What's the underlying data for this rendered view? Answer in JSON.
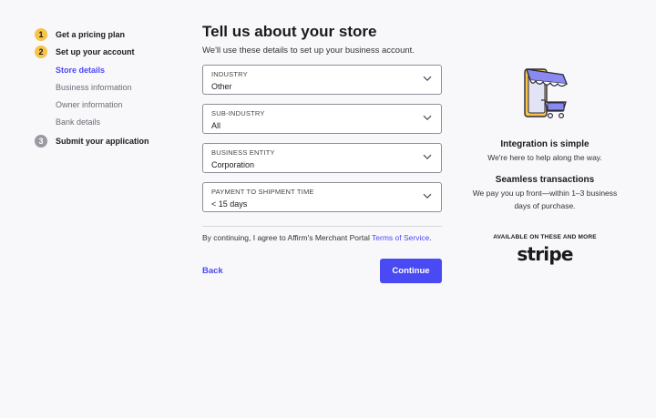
{
  "stepper": {
    "steps": [
      {
        "number": "1",
        "label": "Get a pricing plan"
      },
      {
        "number": "2",
        "label": "Set up your account"
      },
      {
        "number": "3",
        "label": "Submit your application"
      }
    ],
    "substeps": [
      {
        "label": "Store details"
      },
      {
        "label": "Business information"
      },
      {
        "label": "Owner information"
      },
      {
        "label": "Bank details"
      }
    ]
  },
  "form": {
    "title": "Tell us about your store",
    "subtitle": "We'll use these details to set up your business account.",
    "fields": [
      {
        "label": "INDUSTRY",
        "value": "Other"
      },
      {
        "label": "SUB-INDUSTRY",
        "value": "All"
      },
      {
        "label": "BUSINESS ENTITY",
        "value": "Corporation"
      },
      {
        "label": "PAYMENT TO SHIPMENT TIME",
        "value": "< 15 days"
      }
    ],
    "consent_text": "By continuing, I agree to Affirm's Merchant Portal ",
    "consent_link": "Terms of Service",
    "consent_end": ".",
    "back_label": "Back",
    "continue_label": "Continue"
  },
  "info": {
    "title1": "Integration is simple",
    "text1": "We're here to help along the way.",
    "title2": "Seamless transactions",
    "text2": "We pay you up front—within 1–3 business days of purchase.",
    "partners_label": "AVAILABLE ON THESE AND MORE",
    "partner_logo": "stripe"
  },
  "colors": {
    "accent": "#4a4af4",
    "step_active": "#f7c348",
    "step_inactive": "#9a9aa3"
  }
}
